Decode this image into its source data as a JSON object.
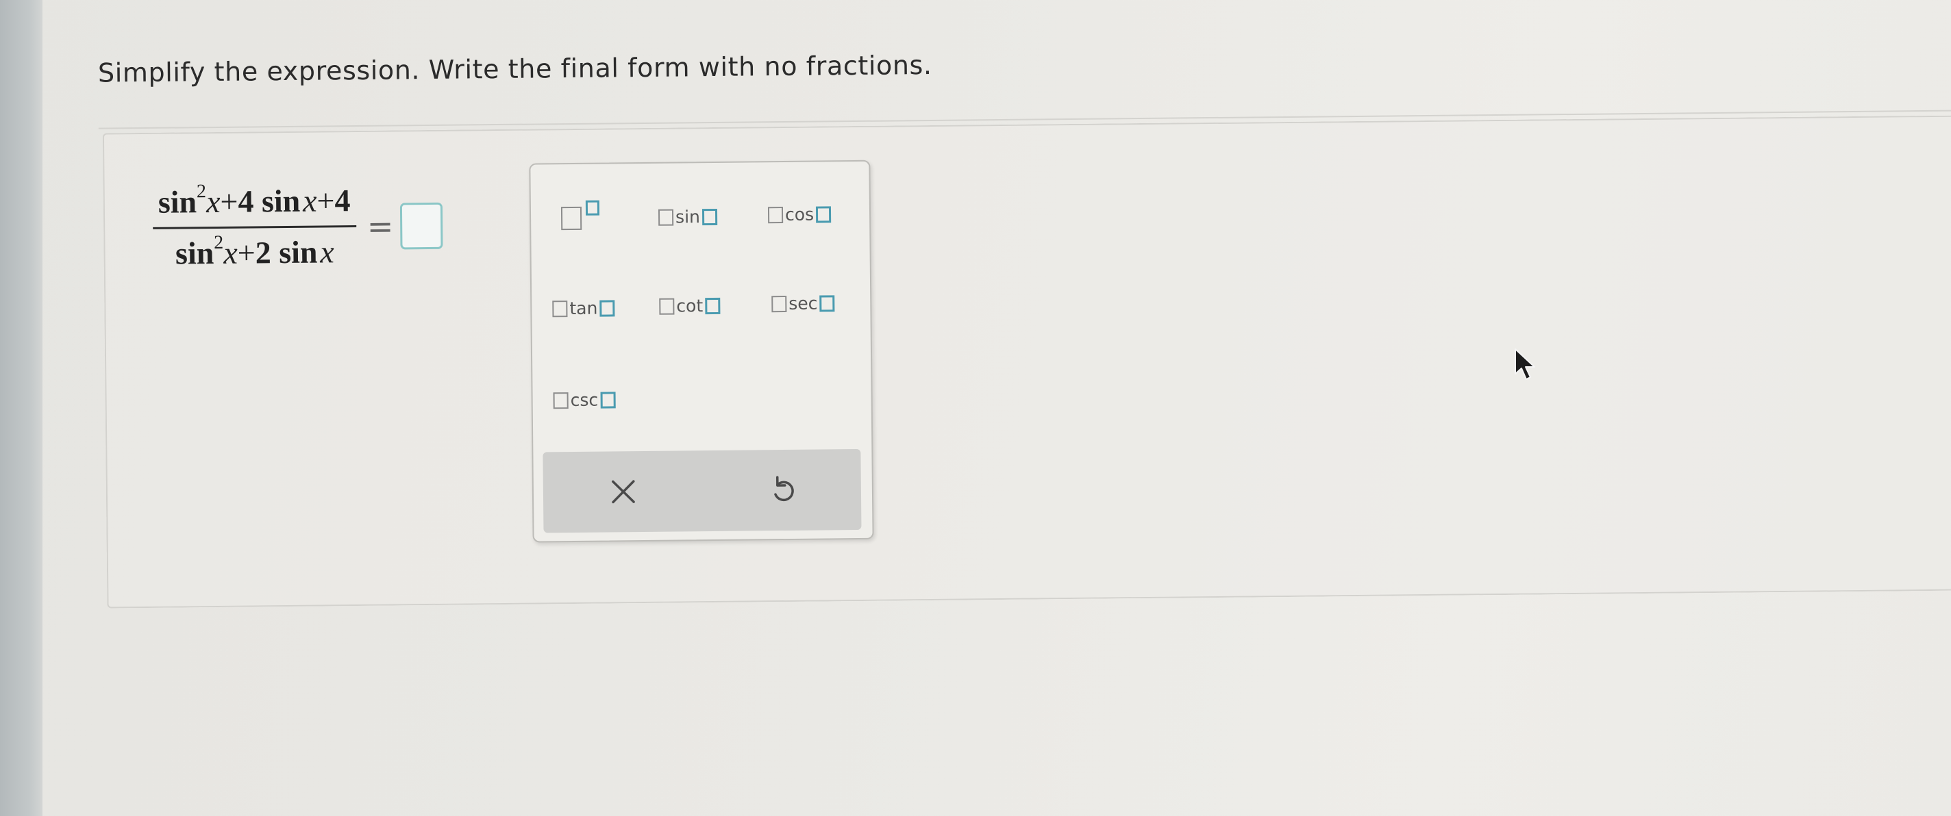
{
  "prompt": "Simplify the expression. Write the final form with no fractions.",
  "expression": {
    "numerator": {
      "sin": "sin",
      "exp": "2",
      "x1": "x",
      "plus1": "+",
      "coef": "4",
      "sin2": "sin",
      "x2": "x",
      "plus2": "+",
      "const": "4"
    },
    "denominator": {
      "sin": "sin",
      "exp": "2",
      "x1": "x",
      "plus1": "+",
      "coef": "2",
      "sin2": "sin",
      "x2": "x"
    },
    "equals": "=",
    "answer_value": ""
  },
  "keypad": {
    "power_icon": "power-template-icon",
    "functions": [
      {
        "label": "sin"
      },
      {
        "label": "cos"
      },
      {
        "label": "tan"
      },
      {
        "label": "cot"
      },
      {
        "label": "sec"
      },
      {
        "label": "csc"
      }
    ],
    "clear_icon": "close-icon",
    "undo_icon": "undo-icon"
  },
  "colors": {
    "accent": "#4a9bb0",
    "answer_border": "#8bc7c7",
    "action_bar": "#cfcfcd",
    "text": "#2b2b2b"
  }
}
